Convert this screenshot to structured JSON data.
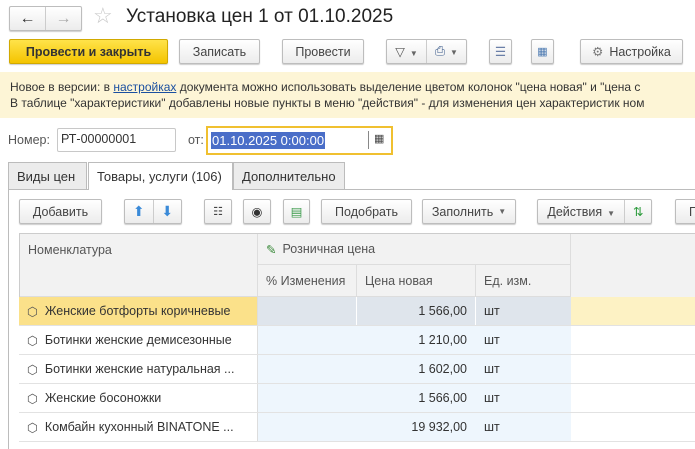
{
  "header": {
    "title": "Установка цен 1 от 01.10.2025",
    "back_icon": "arrow-left",
    "forward_icon": "arrow-right",
    "star_icon": "star"
  },
  "toolbar": {
    "post_close": "Провести и закрыть",
    "save": "Записать",
    "post": "Провести",
    "settings": "Настройка"
  },
  "info": {
    "line1_pre": "Новое в версии: в ",
    "line1_link": "настройках",
    "line1_post": " документа можно использовать выделение цветом колонок \"цена новая\" и \"цена с",
    "line2": "В таблице \"характеристики\" добавлены новые пункты в меню \"действия\" - для изменения цен характеристик ном"
  },
  "form": {
    "number_label": "Номер:",
    "number_value": "РТ-00000001",
    "date_label": "от:",
    "date_value": "01.10.2025  0:00:00"
  },
  "tabs": [
    {
      "label": "Виды цен"
    },
    {
      "label": "Товары, услуги (106)"
    },
    {
      "label": "Дополнительно"
    }
  ],
  "table_toolbar": {
    "add": "Добавить",
    "pick": "Подобрать",
    "fill": "Заполнить",
    "actions": "Действия"
  },
  "table": {
    "col_name": "Номенклатура",
    "group_header": "Розничная цена",
    "col_pct": "% Изменения",
    "col_price": "Цена новая",
    "col_unit": "Ед. изм.",
    "rows": [
      {
        "name": "Женские ботфорты коричневые",
        "price": "1 566,00",
        "unit": "шт"
      },
      {
        "name": "Ботинки женские демисезонные",
        "price": "1 210,00",
        "unit": "шт"
      },
      {
        "name": "Ботинки женские натуральная ...",
        "price": "1 602,00",
        "unit": "шт"
      },
      {
        "name": "Женские босоножки",
        "price": "1 566,00",
        "unit": "шт"
      },
      {
        "name": "Комбайн кухонный BINATONE ...",
        "price": "19 932,00",
        "unit": "шт"
      }
    ]
  },
  "colors": {
    "accent": "#f4c400",
    "selected_row": "#fbe18a",
    "price_col": "#eef6fd",
    "date_border": "#f0c030",
    "selection": "#4a6ec8"
  }
}
